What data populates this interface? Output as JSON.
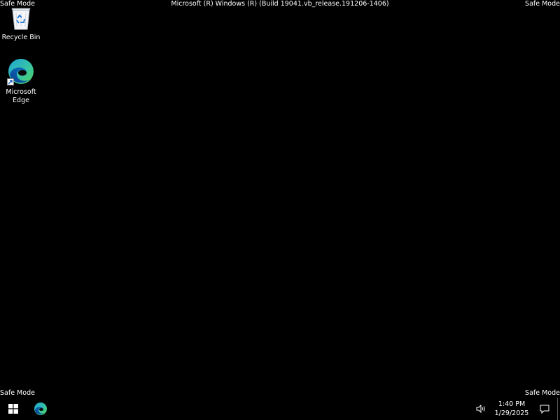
{
  "overlay": {
    "safe_mode_label": "Safe Mode",
    "build_string": "Microsoft (R) Windows (R) (Build 19041.vb_release.191206-1406)"
  },
  "desktop": {
    "icons": [
      {
        "label": "Recycle Bin",
        "icon": "recycle-bin-icon"
      },
      {
        "label": "Microsoft\nEdge",
        "icon": "edge-icon"
      }
    ]
  },
  "taskbar": {
    "pinned": [
      {
        "icon": "windows-start-icon"
      },
      {
        "icon": "edge-icon"
      }
    ],
    "tray": {
      "volume_icon": "speaker-icon",
      "time": "1:40 PM",
      "date": "1/29/2025",
      "notification_icon": "action-center-icon"
    }
  },
  "colors": {
    "background": "#000000",
    "text": "#ffffff",
    "edge_blue": "#0c59a4",
    "edge_green": "#51d25f",
    "edge_teal": "#1fa5d6"
  }
}
